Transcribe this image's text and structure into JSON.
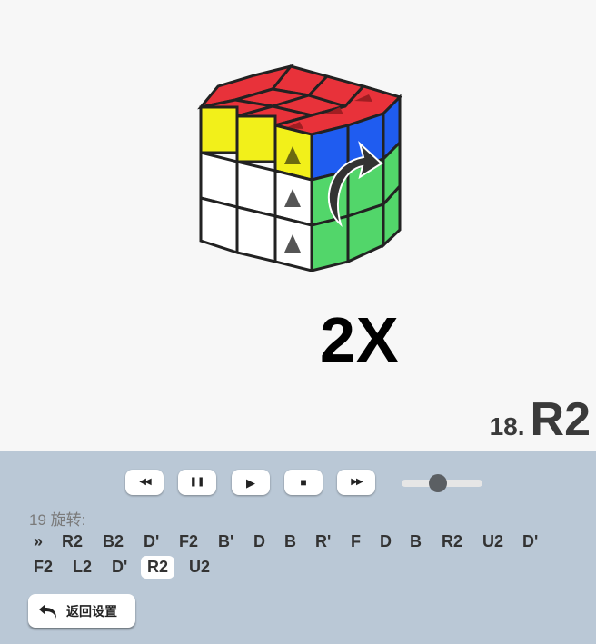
{
  "stage": {
    "multiplier": "2X",
    "current_move_number": "18.",
    "current_move": "R2"
  },
  "controls": {
    "buttons": [
      {
        "name": "rewind-button",
        "glyph": "◀◀"
      },
      {
        "name": "pause-button",
        "glyph": "❚❚"
      },
      {
        "name": "play-button",
        "glyph": "▶"
      },
      {
        "name": "stop-button",
        "glyph": "■"
      },
      {
        "name": "fast-forward-button",
        "glyph": "▶▶"
      }
    ],
    "speed_level": 0.45
  },
  "sequence": {
    "label": "19 旋转:",
    "marker": "»",
    "row1": [
      "R2",
      "B2",
      "D'",
      "F2",
      "B'",
      "D",
      "B",
      "R'",
      "F",
      "D",
      "B",
      "R2",
      "U2",
      "D'"
    ],
    "row2": [
      "F2",
      "L2",
      "D'",
      "R2",
      "U2"
    ],
    "active_row": 2,
    "active_index": 3
  },
  "back_button": {
    "label": "返回设置",
    "icon": "undo-arrow-icon"
  },
  "colors": {
    "panel_bg": "#bac8d6",
    "red": "#e8323a",
    "yellow": "#f2f01a",
    "blue": "#1f5cf0",
    "green": "#52d66a",
    "white": "#ffffff"
  }
}
